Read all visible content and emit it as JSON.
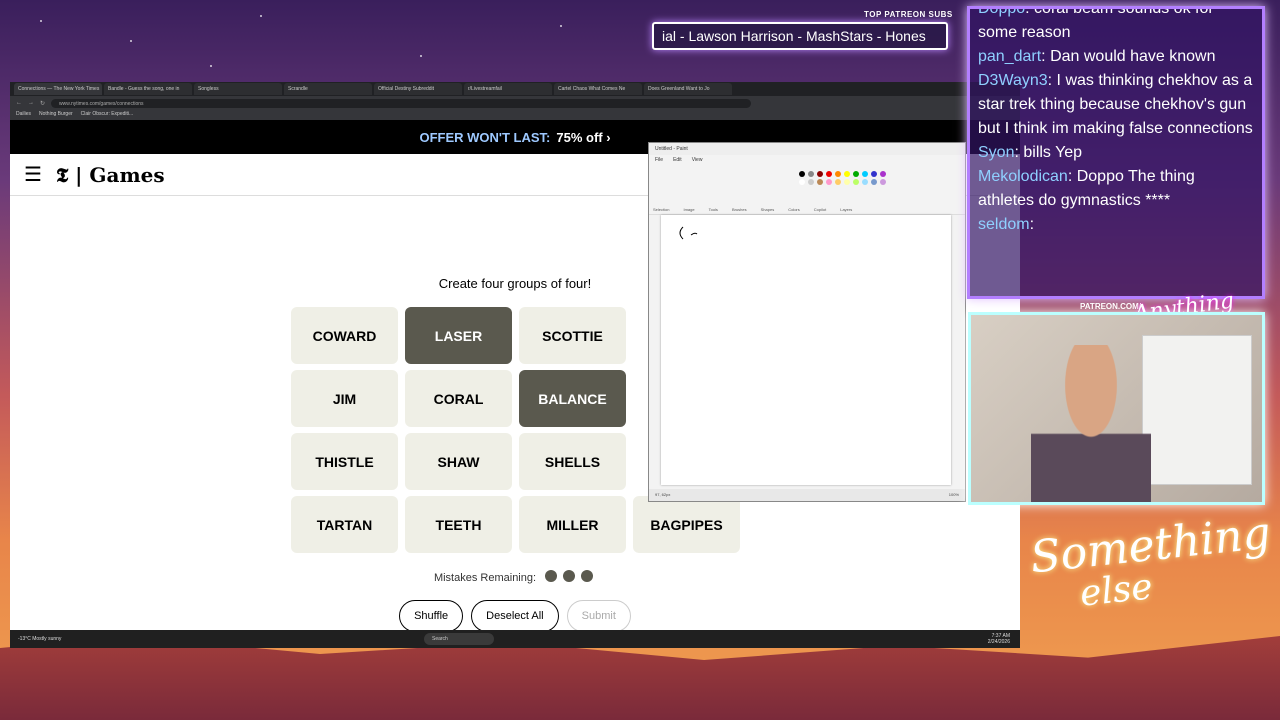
{
  "overlay": {
    "top_patreon_label": "TOP PATREON SUBS",
    "ticker_text": "ial - Lawson Harrison - MashStars - Hones",
    "patreon_url": "PATREON.COM/",
    "brand_small": "Anything else",
    "brand_big_1": "Something",
    "brand_big_2": "else"
  },
  "browser": {
    "tabs": [
      "Connections — The New York Times",
      "Bandle - Guess the song, one in",
      "Songless",
      "Scrandle",
      "Official Destiny Subreddit",
      "r/Livestreamfail",
      "Cartel Chaos What Comes Ne",
      "Does Greenland Want to Jo"
    ],
    "address": "www.nytimes.com/games/connections",
    "bookmarks": [
      "Dailies",
      "Nothing Burger",
      "Clair Obscur: Expediti..."
    ]
  },
  "offer": {
    "highlight": "OFFER WON'T LAST:",
    "text": "75% off ›"
  },
  "games_logo": "Games",
  "prompt": "Create four groups of four!",
  "tiles": [
    {
      "label": "COWARD",
      "selected": false
    },
    {
      "label": "LASER",
      "selected": true
    },
    {
      "label": "SCOTTIE",
      "selected": false
    },
    {
      "label": "",
      "selected": false
    },
    {
      "label": "JIM",
      "selected": false
    },
    {
      "label": "CORAL",
      "selected": false
    },
    {
      "label": "BALANCE",
      "selected": true
    },
    {
      "label": "",
      "selected": false
    },
    {
      "label": "THISTLE",
      "selected": false
    },
    {
      "label": "SHAW",
      "selected": false
    },
    {
      "label": "SHELLS",
      "selected": false
    },
    {
      "label": "",
      "selected": true
    },
    {
      "label": "TARTAN",
      "selected": false
    },
    {
      "label": "TEETH",
      "selected": false
    },
    {
      "label": "MILLER",
      "selected": false
    },
    {
      "label": "BAGPIPES",
      "selected": false
    }
  ],
  "mistakes_label": "Mistakes Remaining:",
  "mistakes_remaining": 3,
  "buttons": {
    "shuffle": "Shuffle",
    "deselect": "Deselect All",
    "submit": "Submit"
  },
  "taskbar": {
    "weather": "-13°C",
    "weather_desc": "Mostly sunny",
    "search": "Search",
    "time": "7:37 AM",
    "date": "2/24/2026"
  },
  "paint": {
    "title": "Untitled - Paint",
    "menu": [
      "File",
      "Edit",
      "View"
    ],
    "groups": [
      "Selection",
      "Image",
      "Tools",
      "Brushes",
      "Shapes",
      "Colors",
      "Copilot",
      "Layers"
    ],
    "status_pos": "97, 62px",
    "zoom": "100%"
  },
  "chat": [
    {
      "user": "Doppo",
      "text": "coral beam sounds ok for some reason"
    },
    {
      "user": "pan_dart",
      "text": "Dan would have known"
    },
    {
      "user": "D3Wayn3",
      "text": "I was thinking chekhov as a star trek thing because chekhov's gun but I think im making false connections"
    },
    {
      "user": "Syon",
      "text": "bills Yep"
    },
    {
      "user": "Mekolodican",
      "text": "Doppo The thing athletes do gymnastics ****"
    },
    {
      "user": "seldom",
      "text": ""
    }
  ],
  "colors": {
    "selected_tile": "#5a594e",
    "tile": "#efefe6",
    "chat_user": "#8fd0ff"
  }
}
